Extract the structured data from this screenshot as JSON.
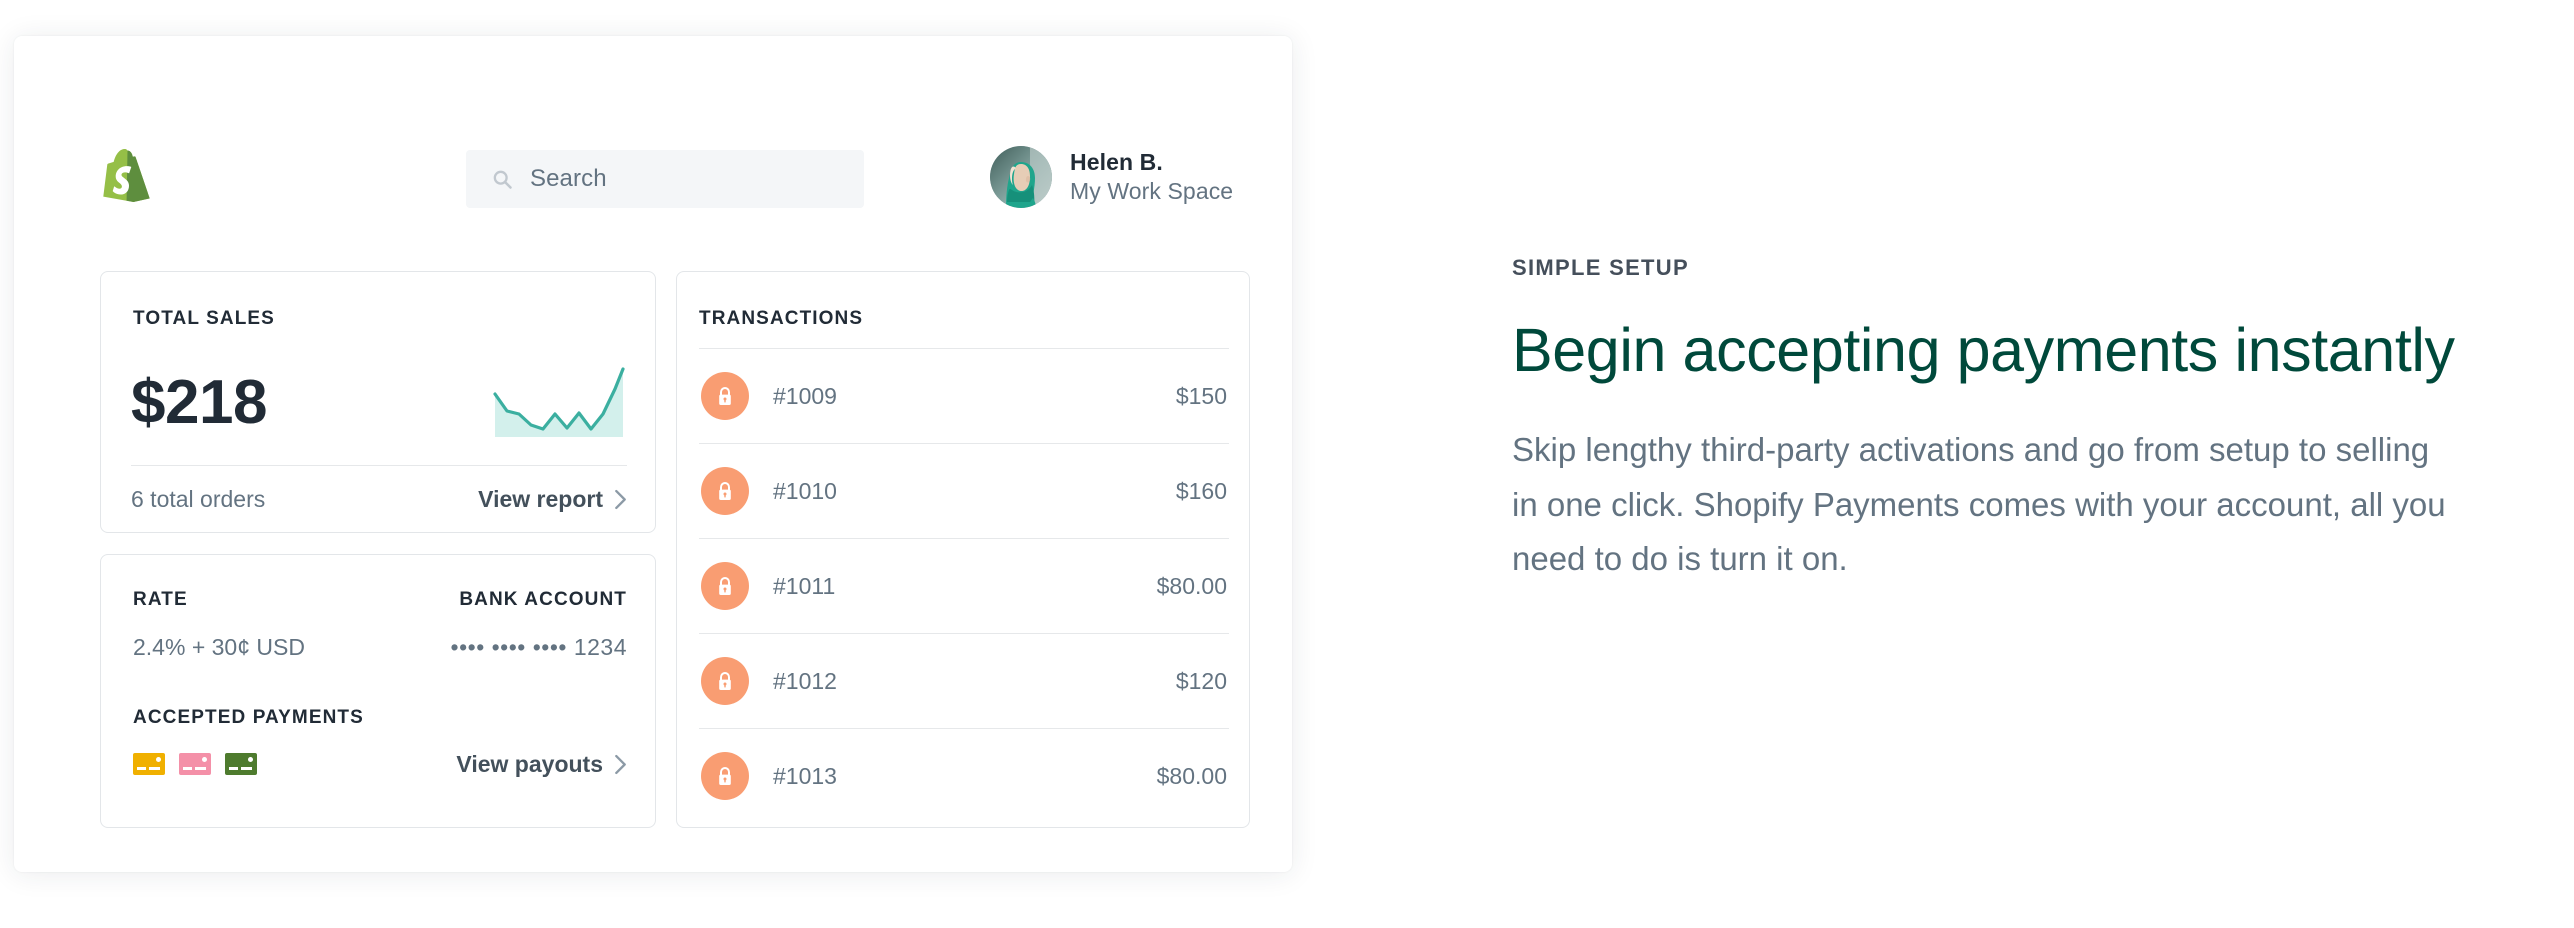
{
  "topbar": {
    "logo_icon": "shopify-bag-logo",
    "search": {
      "icon": "search-icon",
      "placeholder": "Search",
      "value": ""
    },
    "user": {
      "avatar_icon": "user-avatar",
      "name": "Helen B.",
      "workspace": "My Work Space"
    }
  },
  "total_sales_card": {
    "label": "TOTAL SALES",
    "amount": "$218",
    "orders": "6 total orders",
    "link": "View report",
    "chevron_icon": "chevron-right-icon"
  },
  "rate_card": {
    "rate_label": "RATE",
    "rate_value": "2.4% + 30¢ USD",
    "bank_label": "BANK ACCOUNT",
    "bank_value": "•••• •••• •••• 1234",
    "accepted_label": "ACCEPTED PAYMENTS",
    "payouts_link": "View payouts",
    "chevron_icon": "chevron-right-icon",
    "cards": [
      {
        "icon": "credit-card-icon",
        "color": "#F0B000"
      },
      {
        "icon": "credit-card-icon",
        "color": "#F490A8"
      },
      {
        "icon": "credit-card-icon",
        "color": "#4E7B2E"
      }
    ]
  },
  "transactions_card": {
    "label": "TRANSACTIONS",
    "rows": [
      {
        "icon": "lock-icon",
        "id": "#1009",
        "amount": "$150"
      },
      {
        "icon": "lock-icon",
        "id": "#1010",
        "amount": "$160"
      },
      {
        "icon": "lock-icon",
        "id": "#1011",
        "amount": "$80.00"
      },
      {
        "icon": "lock-icon",
        "id": "#1012",
        "amount": "$120"
      },
      {
        "icon": "lock-icon",
        "id": "#1013",
        "amount": "$80.00"
      }
    ]
  },
  "marketing": {
    "eyebrow": "SIMPLE SETUP",
    "headline": "Begin accepting payments instantly",
    "body": "Skip lengthy third-party activations and go from setup to selling in one click. Shopify Payments comes with your account, all you need to do is turn it on."
  },
  "chart_data": {
    "type": "area",
    "title": "Total sales sparkline",
    "x": [
      0,
      1,
      2,
      3,
      4,
      5,
      6,
      7,
      8,
      9,
      10,
      11
    ],
    "values": [
      62,
      38,
      34,
      18,
      12,
      34,
      14,
      36,
      12,
      34,
      70,
      100
    ],
    "ylim": [
      0,
      100
    ],
    "grid": false,
    "line_color": "#3BAFA0",
    "fill_color": "#D3F0EC"
  },
  "colors": {
    "brand_green": "#95BF47",
    "brand_green_dark": "#5E8E3E",
    "headline_green": "#00493B",
    "teal_accent": "#3BAFA0",
    "teal_fill": "#D3F0EC",
    "lock_badge": "#F99D72",
    "text_primary": "#212B36",
    "text_secondary": "#637381",
    "card_border": "#E3E6E9",
    "search_bg": "#F4F6F8"
  }
}
